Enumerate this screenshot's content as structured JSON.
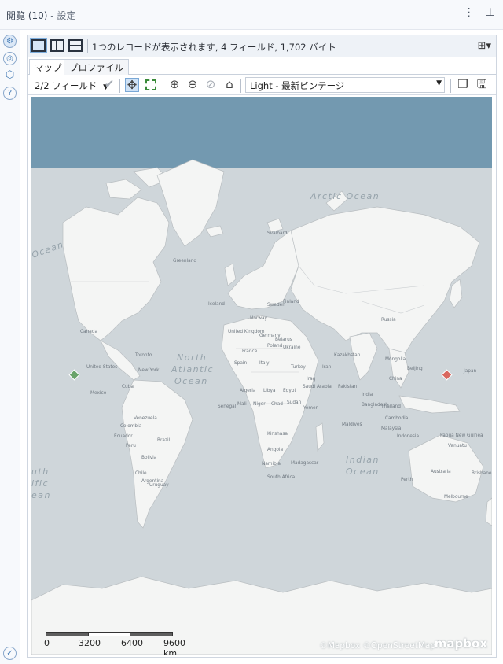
{
  "title": {
    "main": "閲覧 (10)",
    "sub": "- 設定"
  },
  "titlebar_icons": {
    "more": "⋮",
    "pin": "⊥"
  },
  "left_icons": [
    "gear-icon",
    "settings-circle-icon",
    "tag-icon",
    "help-icon",
    "check-icon"
  ],
  "toolbar": {
    "record_info": "1つのレコードが表示されます, 4 フィールド, 1,702 バイト",
    "add_icon": "⊞▾"
  },
  "tabs": [
    {
      "label": "マップ"
    },
    {
      "label": "プロファイル"
    }
  ],
  "map_toolbar": {
    "field_select": "2/2 フィールド",
    "style_select": "Light - 最新ビンテージ"
  },
  "map": {
    "labels": {
      "arctic_ocean": "Arctic Ocean",
      "north_atlantic_1": "North",
      "north_atlantic_2": "Atlantic",
      "north_atlantic_3": "Ocean",
      "indian_ocean_1": "Indian",
      "indian_ocean_2": "Ocean",
      "pacific_left_1": "uth",
      "pacific_left_2": "ific",
      "pacific_left_3": "ean",
      "ocean_nw": "Ocean",
      "greenland": "Greenland",
      "iceland": "Iceland",
      "canada": "Canada",
      "united_states": "United States",
      "russia": "Russia",
      "china": "China",
      "australia": "Australia",
      "brazil": "Brazil",
      "kazakhstan": "Kazakhstan",
      "india": "India",
      "algeria": "Algeria",
      "libya": "Libya",
      "egypt": "Egypt",
      "mali": "Mali",
      "niger": "Niger",
      "chad": "Chad",
      "sudan": "Sudan",
      "kinshasa": "Kinshasa",
      "namibia": "Namibia",
      "south_africa": "South Africa",
      "madagascar": "Madagascar",
      "peru": "Peru",
      "bolivia": "Bolivia",
      "chile": "Chile",
      "argentina": "Argentina",
      "venezuela": "Venezuela",
      "colombia": "Colombia",
      "ecuador": "Ecuador",
      "uruguay": "Uruguay",
      "mexico": "Mexico",
      "cuba": "Cuba",
      "sweden": "Sweden",
      "norway": "Norway",
      "finland": "Finland",
      "poland": "Poland",
      "ukraine": "Ukraine",
      "france": "France",
      "spain": "Spain",
      "italy": "Italy",
      "turkey": "Turkey",
      "iran": "Iran",
      "iraq": "Iraq",
      "pakistan": "Pakistan",
      "mongolia": "Mongolia",
      "beijing": "Beijing",
      "bangladesh": "Bangladesh",
      "thailand": "Thailand",
      "cambodia": "Cambodia",
      "malaysia": "Malaysia",
      "indonesia": "Indonesia",
      "maldives": "Maldives",
      "papua_new_guinea": "Papua New Guinea",
      "vanuatu": "Vanuatu",
      "perth": "Perth",
      "melbourne": "Melbourne",
      "brisbane": "Brisbane",
      "toronto": "Toronto",
      "new_york": "New York",
      "svalbard": "Svalbard",
      "senegal": "Senegal",
      "angola": "Angola",
      "yemen": "Yemen",
      "saudi_arabia": "Saudi Arabia",
      "belarus": "Belarus",
      "germany": "Germany",
      "united_kingdom": "United Kingdom",
      "japan": "Japan"
    },
    "markers": [
      {
        "name": "marker-united-states",
        "color": "#6aa36a",
        "place": "United States (west coast)"
      },
      {
        "name": "marker-japan",
        "color": "#d9675f",
        "place": "Japan"
      }
    ],
    "scalebar_labels": [
      "0",
      "3200",
      "6400",
      "9600 km"
    ],
    "attribution": "©Mapbox ©OpenStreetMap",
    "logo": "mapbox"
  },
  "colors": {
    "water_top": "#7399b0",
    "water": "#cfd6da",
    "land": "#f4f5f4",
    "border": "#b9bec1"
  }
}
